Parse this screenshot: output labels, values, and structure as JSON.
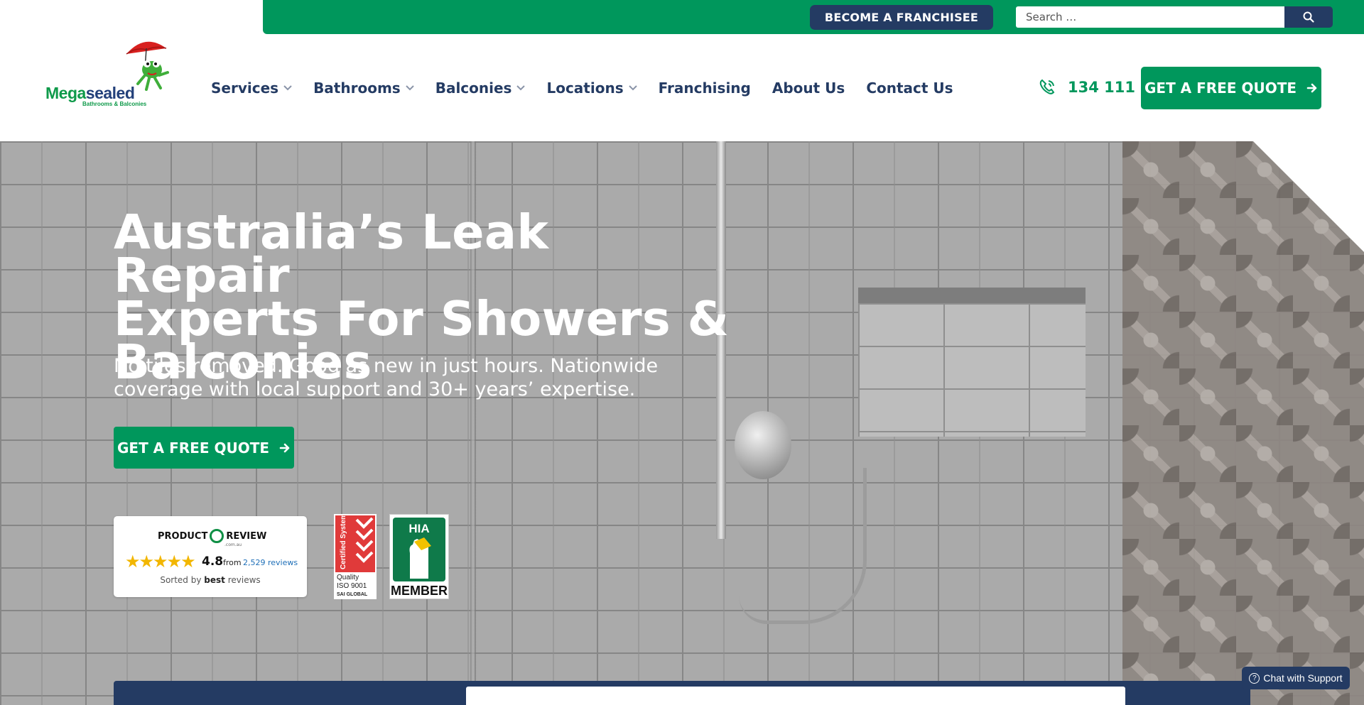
{
  "topbar": {
    "franchisee_label": "BECOME A FRANCHISEE",
    "search_placeholder": "Search …",
    "search_icon": "search-icon"
  },
  "brand": {
    "name_part1": "Mega",
    "name_part2": "sealed",
    "tagline": "Bathrooms & Balconies",
    "mascot": "frog-with-umbrella"
  },
  "nav": {
    "items": [
      {
        "label": "Services",
        "has_dropdown": true
      },
      {
        "label": "Bathrooms",
        "has_dropdown": true
      },
      {
        "label": "Balconies",
        "has_dropdown": true
      },
      {
        "label": "Locations",
        "has_dropdown": true
      },
      {
        "label": "Franchising",
        "has_dropdown": false
      },
      {
        "label": "About Us",
        "has_dropdown": false
      },
      {
        "label": "Contact Us",
        "has_dropdown": false
      }
    ]
  },
  "phone": {
    "number": "134 111",
    "icon": "phone-icon"
  },
  "cta": {
    "label": "GET A FREE QUOTE",
    "icon": "arrow-right-icon"
  },
  "hero": {
    "title_line1": "Australia’s Leak Repair",
    "title_line2": "Experts For Showers &",
    "title_line3": "Balconies",
    "subtitle": "No tiles removed. Good as new in just hours. Nationwide coverage with local support and 30+ years’ expertise.",
    "cta_label": "GET A FREE QUOTE"
  },
  "review_widget": {
    "brand_left": "PRODUCT",
    "brand_right": "REVIEW",
    "brand_domain": ".com.au",
    "rating": "4.8",
    "from_label": "from",
    "count_label": "2,529 reviews",
    "sorted_prefix": "Sorted by",
    "sorted_bold": "best",
    "sorted_suffix": "reviews",
    "stars": 5
  },
  "badges": {
    "iso_vertical": "Certified System",
    "iso_line1": "Quality",
    "iso_line2": "ISO 9001",
    "iso_org": "SAI GLOBAL",
    "hia_title": "HIA",
    "hia_member": "MEMBER"
  },
  "chat": {
    "label": "Chat with Support"
  },
  "colors": {
    "brand_green": "#00975c",
    "navy": "#243b63",
    "star": "#f2b600"
  }
}
